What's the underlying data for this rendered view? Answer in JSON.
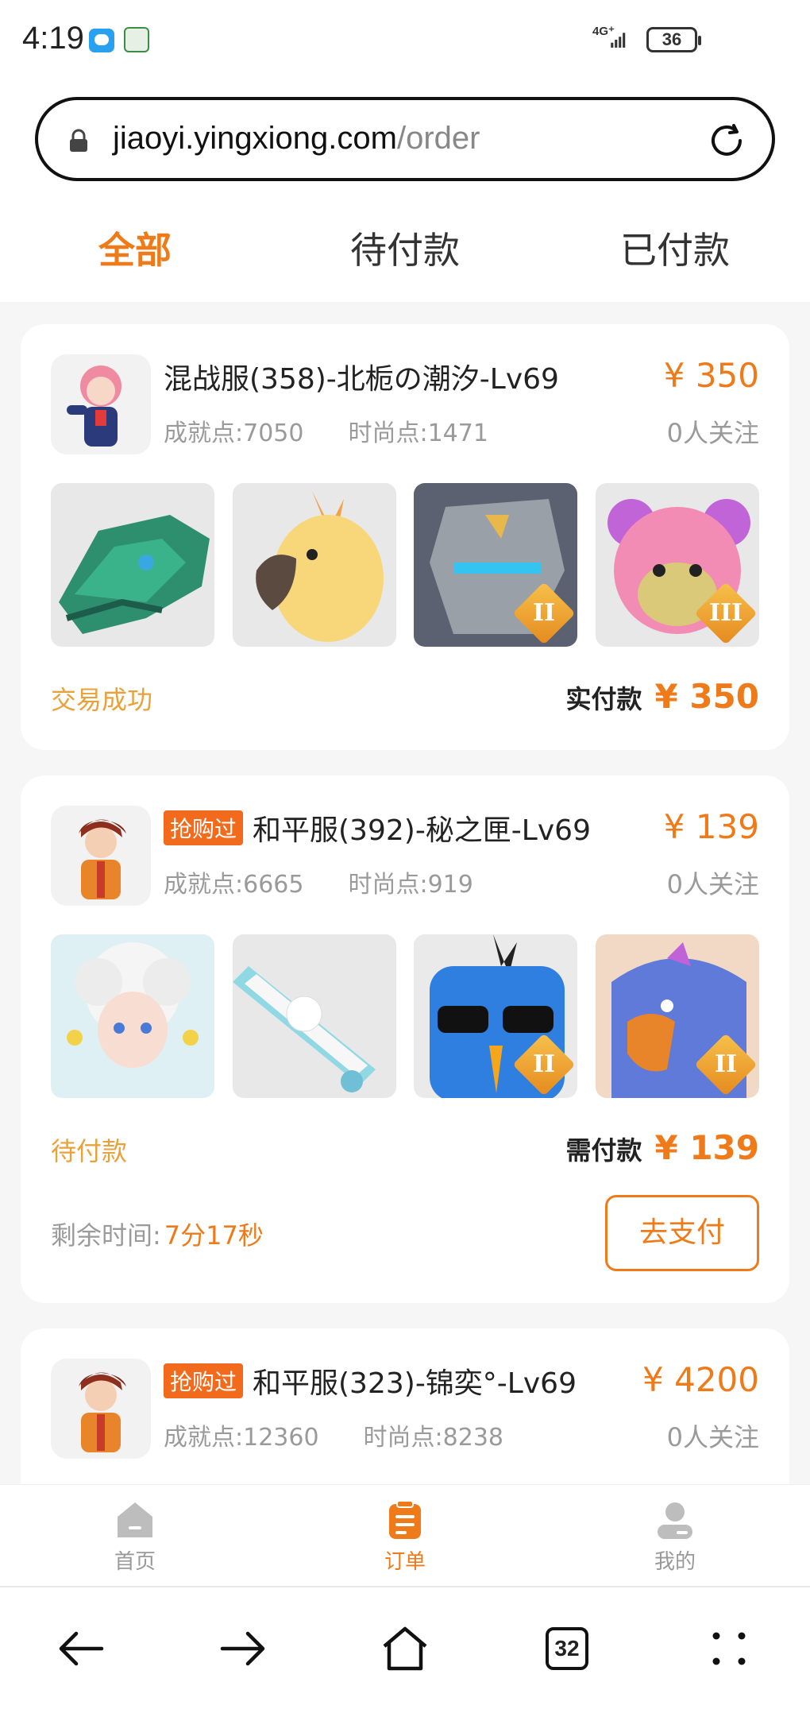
{
  "status_bar": {
    "time": "4:19",
    "network": "4G⁺",
    "battery": "36"
  },
  "browser": {
    "url_domain": "jiaoyi.yingxiong.com",
    "url_path": "/order",
    "tab_count": "32"
  },
  "tabs": [
    {
      "label": "全部",
      "active": true
    },
    {
      "label": "待付款",
      "active": false
    },
    {
      "label": "已付款",
      "active": false
    }
  ],
  "orders": [
    {
      "title": "混战服(358)-北栀の潮汐-Lv69",
      "badge": "",
      "achievement": "成就点:7050",
      "fashion": "时尚点:1471",
      "price": "¥ 350",
      "follow": "0人关注",
      "items": [
        {
          "icon": "green-dragon-head",
          "rank": ""
        },
        {
          "icon": "cockatoo-head",
          "rank": ""
        },
        {
          "icon": "stone-golem-head",
          "rank": "II"
        },
        {
          "icon": "pink-bear-head",
          "rank": "III"
        }
      ],
      "status": "交易成功",
      "paid_label": "实付款",
      "paid_amount": "¥ 350"
    },
    {
      "title": "和平服(392)-秘之匣-Lv69",
      "badge": "抢购过",
      "achievement": "成就点:6665",
      "fashion": "时尚点:919",
      "price": "¥ 139",
      "follow": "0人关注",
      "items": [
        {
          "icon": "white-haired-doll",
          "rank": ""
        },
        {
          "icon": "bear-skateboard",
          "rank": ""
        },
        {
          "icon": "blue-bird-sunglasses",
          "rank": "II"
        },
        {
          "icon": "blue-eagle-head",
          "rank": "II"
        }
      ],
      "status": "待付款",
      "paid_label": "需付款",
      "paid_amount": "¥ 139",
      "remain_label": "剩余时间:",
      "remain_time": "7分17秒",
      "pay_button": "去支付"
    },
    {
      "title": "和平服(323)-锦奕°-Lv69",
      "badge": "抢购过",
      "achievement": "成就点:12360",
      "fashion": "时尚点:8238",
      "price": "¥ 4200",
      "follow": "0人关注"
    }
  ],
  "app_nav": [
    {
      "label": "首页",
      "icon": "home-icon",
      "active": false
    },
    {
      "label": "订单",
      "icon": "order-icon",
      "active": true
    },
    {
      "label": "我的",
      "icon": "profile-icon",
      "active": false
    }
  ],
  "colors": {
    "accent": "#ef7a1a",
    "badge": "#f26a1b",
    "status_gold": "#e9a13a"
  }
}
